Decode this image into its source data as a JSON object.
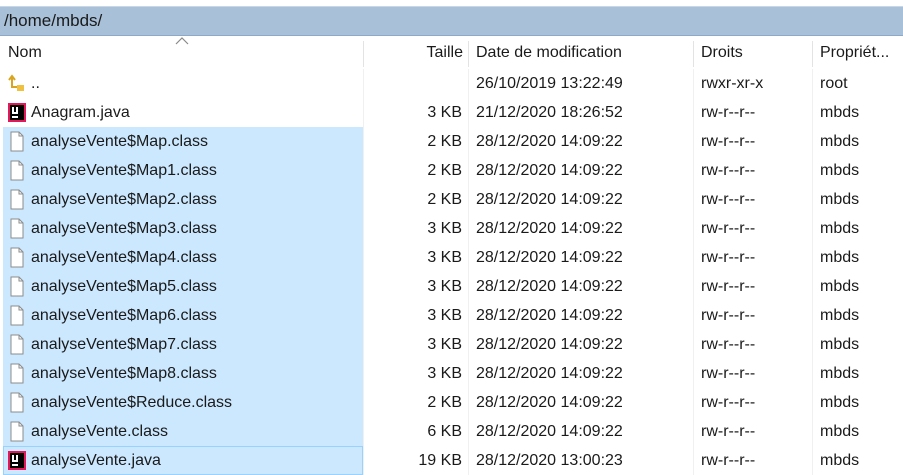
{
  "path": {
    "text": "/home/mbds/"
  },
  "columns": {
    "name": "Nom",
    "size": "Taille",
    "date": "Date de modification",
    "rights": "Droits",
    "owner": "Propriét..."
  },
  "files": [
    {
      "name": "..",
      "size": "",
      "date": "26/10/2019 13:22:49",
      "rights": "rwxr-xr-x",
      "owner": "root",
      "icon": "parent-folder-icon",
      "selected": false
    },
    {
      "name": "Anagram.java",
      "size": "3 KB",
      "date": "21/12/2020 18:26:52",
      "rights": "rw-r--r--",
      "owner": "mbds",
      "icon": "intellij-icon",
      "selected": false
    },
    {
      "name": "analyseVente$Map.class",
      "size": "2 KB",
      "date": "28/12/2020 14:09:22",
      "rights": "rw-r--r--",
      "owner": "mbds",
      "icon": "file-icon",
      "selected": true
    },
    {
      "name": "analyseVente$Map1.class",
      "size": "2 KB",
      "date": "28/12/2020 14:09:22",
      "rights": "rw-r--r--",
      "owner": "mbds",
      "icon": "file-icon",
      "selected": true
    },
    {
      "name": "analyseVente$Map2.class",
      "size": "2 KB",
      "date": "28/12/2020 14:09:22",
      "rights": "rw-r--r--",
      "owner": "mbds",
      "icon": "file-icon",
      "selected": true
    },
    {
      "name": "analyseVente$Map3.class",
      "size": "3 KB",
      "date": "28/12/2020 14:09:22",
      "rights": "rw-r--r--",
      "owner": "mbds",
      "icon": "file-icon",
      "selected": true
    },
    {
      "name": "analyseVente$Map4.class",
      "size": "3 KB",
      "date": "28/12/2020 14:09:22",
      "rights": "rw-r--r--",
      "owner": "mbds",
      "icon": "file-icon",
      "selected": true
    },
    {
      "name": "analyseVente$Map5.class",
      "size": "3 KB",
      "date": "28/12/2020 14:09:22",
      "rights": "rw-r--r--",
      "owner": "mbds",
      "icon": "file-icon",
      "selected": true
    },
    {
      "name": "analyseVente$Map6.class",
      "size": "3 KB",
      "date": "28/12/2020 14:09:22",
      "rights": "rw-r--r--",
      "owner": "mbds",
      "icon": "file-icon",
      "selected": true
    },
    {
      "name": "analyseVente$Map7.class",
      "size": "3 KB",
      "date": "28/12/2020 14:09:22",
      "rights": "rw-r--r--",
      "owner": "mbds",
      "icon": "file-icon",
      "selected": true
    },
    {
      "name": "analyseVente$Map8.class",
      "size": "3 KB",
      "date": "28/12/2020 14:09:22",
      "rights": "rw-r--r--",
      "owner": "mbds",
      "icon": "file-icon",
      "selected": true
    },
    {
      "name": "analyseVente$Reduce.class",
      "size": "2 KB",
      "date": "28/12/2020 14:09:22",
      "rights": "rw-r--r--",
      "owner": "mbds",
      "icon": "file-icon",
      "selected": true
    },
    {
      "name": "analyseVente.class",
      "size": "6 KB",
      "date": "28/12/2020 14:09:22",
      "rights": "rw-r--r--",
      "owner": "mbds",
      "icon": "file-icon",
      "selected": true
    },
    {
      "name": "analyseVente.java",
      "size": "19 KB",
      "date": "28/12/2020 13:00:23",
      "rights": "rw-r--r--",
      "owner": "mbds",
      "icon": "intellij-icon",
      "selected": true
    }
  ],
  "colors": {
    "path_bar": "#a8c0d8",
    "selection": "#cce8ff",
    "selection_border": "#99d1ff"
  }
}
